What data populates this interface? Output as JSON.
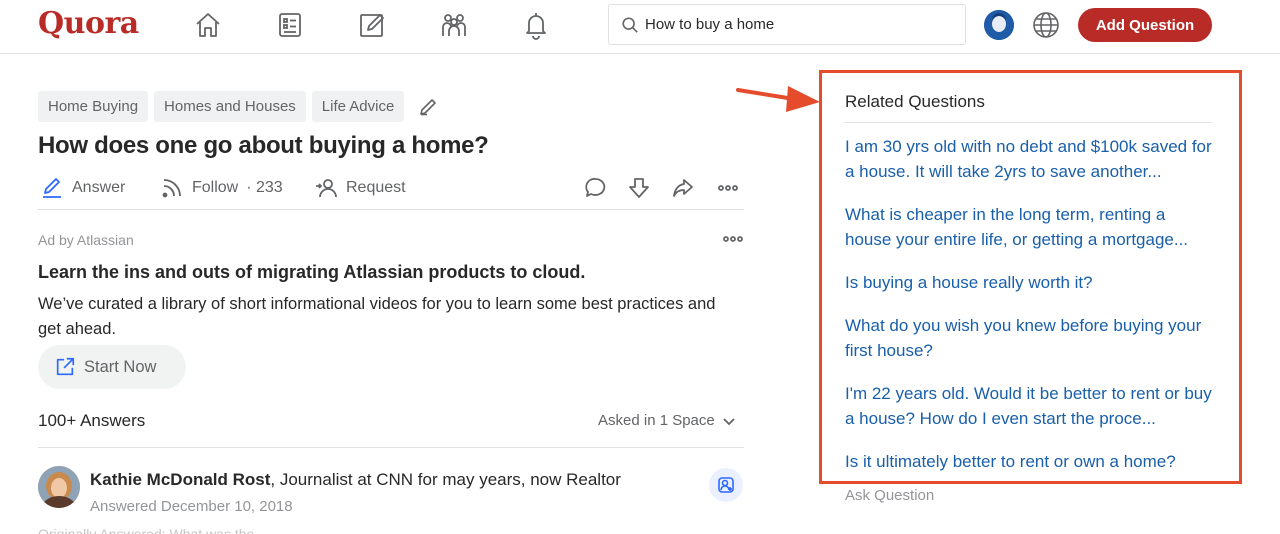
{
  "header": {
    "logo": "Quora",
    "search_value": "How to buy a home",
    "add_question_label": "Add Question",
    "nav_icons": [
      "home-icon",
      "following-icon",
      "answer-icon",
      "spaces-icon",
      "notifications-icon"
    ]
  },
  "question": {
    "topics": [
      "Home Buying",
      "Homes and Houses",
      "Life Advice"
    ],
    "title": "How does one go about buying a home?",
    "actions": {
      "answer_label": "Answer",
      "follow_label": "Follow",
      "follow_count": "· 233",
      "request_label": "Request"
    }
  },
  "ad": {
    "sponsor": "Ad by Atlassian",
    "title": "Learn the ins and outs of migrating Atlassian products to cloud.",
    "body": "We’ve curated a library of short informational videos for you to learn some best practices and get ahead.",
    "cta_label": "Start Now"
  },
  "answers": {
    "count_label": "100+ Answers",
    "asked_in_label": "Asked in 1 Space",
    "first": {
      "author": "Kathie McDonald Rost",
      "credential": ", Journalist at CNN for may years, now Realtor",
      "date": "Answered December 10, 2018",
      "preview": "Originally Answered: What was the ..."
    }
  },
  "related": {
    "title": "Related Questions",
    "items": [
      "I am 30 yrs old with no debt and $100k saved for a house. It will take 2yrs to save another...",
      "What is cheaper in the long term, renting a house your entire life, or getting a mortgage...",
      "Is buying a house really worth it?",
      "What do you wish you knew before buying your first house?",
      "I'm 22 years old. Would it be better to rent or buy a house? How do I even start the proce...",
      "Is it ultimately better to rent or own a home?"
    ],
    "ask_label": "Ask Question"
  },
  "colors": {
    "brand": "#b92b27",
    "link": "#195faa",
    "annotation": "#e44c2c"
  }
}
